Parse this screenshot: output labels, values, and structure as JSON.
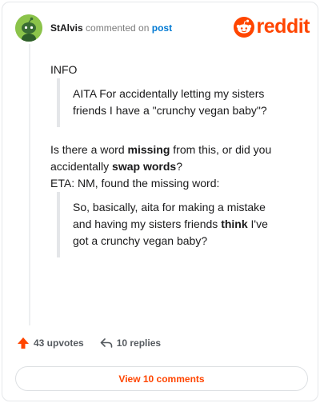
{
  "colors": {
    "brand": "#ff4500",
    "link": "#0079d3",
    "avatar": "#8bc34a"
  },
  "header": {
    "username": "StAlvis",
    "action_text": "commented on",
    "post_link": "post",
    "logo_text": "reddit",
    "icons": {
      "avatar": "snoo-avatar-icon",
      "logo": "reddit-snoo-logo-icon"
    }
  },
  "comment": {
    "info": "INFO",
    "quote1": "AITA For accidentally letting my sisters friends I have a \"crunchy vegan baby\"?",
    "p2": {
      "pre": "Is there a word ",
      "bold1": "missing",
      "mid": " from this, or did you accidentally ",
      "bold2": "swap words",
      "post": "?"
    },
    "p3": "ETA: NM, found the missing word:",
    "quote2": {
      "pre": "So, basically, aita for making a mistake and having my sisters friends ",
      "bold": "think",
      "post": " I've got a crunchy vegan baby?"
    }
  },
  "actions": {
    "upvotes": "43 upvotes",
    "replies": "10 replies",
    "icons": {
      "upvote": "upvote-arrow-icon",
      "reply": "reply-arrow-icon"
    }
  },
  "footer": {
    "view_comments": "View 10 comments"
  }
}
